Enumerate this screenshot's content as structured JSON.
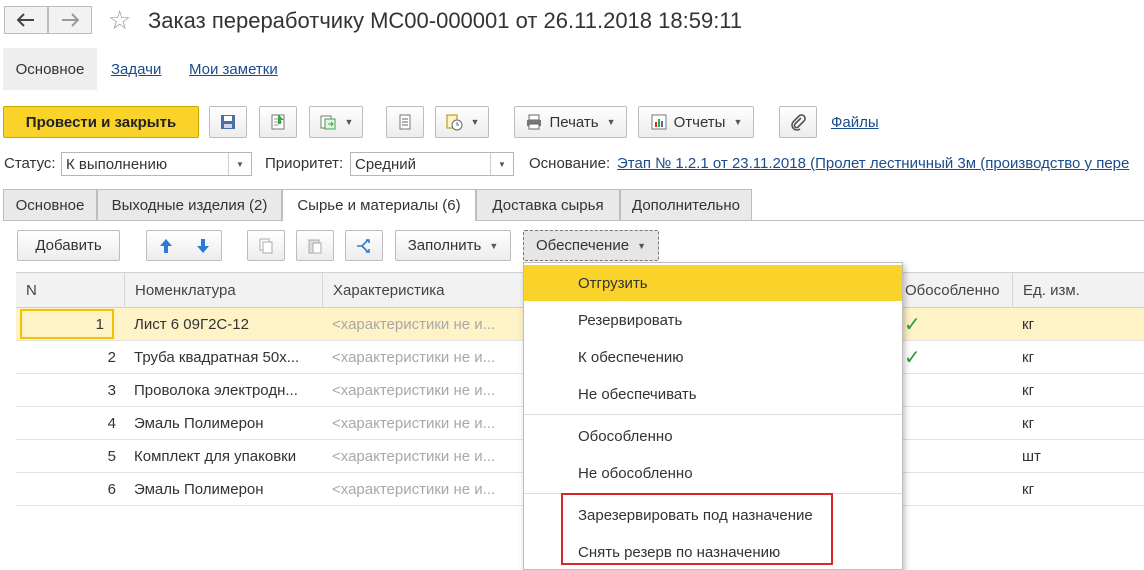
{
  "header": {
    "title": "Заказ переработчику МС00-000001 от 26.11.2018 18:59:11"
  },
  "top_tabs": [
    "Основное",
    "Задачи",
    "Мои заметки"
  ],
  "toolbar": {
    "post_close": "Провести и закрыть",
    "print": "Печать",
    "reports": "Отчеты",
    "files": "Файлы"
  },
  "fields": {
    "status_label": "Статус:",
    "status_value": "К выполнению",
    "priority_label": "Приоритет:",
    "priority_value": "Средний",
    "basis_label": "Основание:",
    "basis_value": "Этап № 1.2.1 от 23.11.2018 (Пролет лестничный 3м (производство у пере"
  },
  "form_tabs": [
    "Основное",
    "Выходные изделия (2)",
    "Сырье и материалы (6)",
    "Доставка сырья",
    "Дополнительно"
  ],
  "table_toolbar": {
    "add": "Добавить",
    "fill": "Заполнить",
    "supply": "Обеспечение"
  },
  "table": {
    "columns": [
      "N",
      "Номенклатура",
      "Характеристика",
      "Обособленно",
      "Ед. изм."
    ],
    "rows": [
      {
        "n": "1",
        "name": "Лист 6 09Г2С-12",
        "char": "<характеристики не и...",
        "isolated": true,
        "unit": "кг"
      },
      {
        "n": "2",
        "name": "Труба квадратная 50х...",
        "char": "<характеристики не и...",
        "isolated": true,
        "unit": "кг"
      },
      {
        "n": "3",
        "name": "Проволока электродн...",
        "char": "<характеристики не и...",
        "isolated": false,
        "unit": "кг"
      },
      {
        "n": "4",
        "name": "Эмаль Полимерон",
        "char": "<характеристики не и...",
        "isolated": false,
        "unit": "кг"
      },
      {
        "n": "5",
        "name": "Комплект для упаковки",
        "char": "<характеристики не и...",
        "isolated": false,
        "unit": "шт"
      },
      {
        "n": "6",
        "name": "Эмаль Полимерон",
        "char": "<характеристики не и...",
        "isolated": false,
        "unit": "кг"
      }
    ]
  },
  "menu": {
    "items": [
      "Отгрузить",
      "Резервировать",
      "К обеспечению",
      "Не обеспечивать",
      "Обособленно",
      "Не обособленно",
      "Зарезервировать под назначение",
      "Снять резерв по назначению"
    ]
  },
  "colors": {
    "accent": "#f9d32a",
    "link": "#1a4b8c",
    "check": "#2e9a3c",
    "highlight_box": "#d9262a"
  }
}
